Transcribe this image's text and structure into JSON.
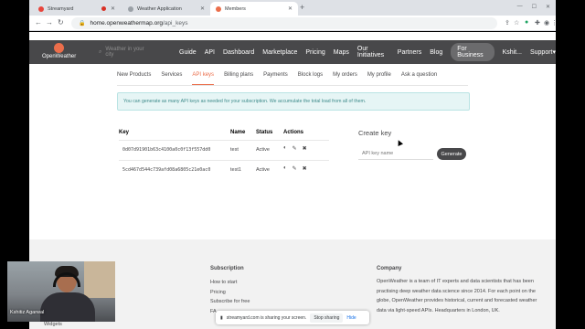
{
  "tabs": [
    {
      "title": "Streamyard",
      "favicon_color": "#e8453c",
      "recording": true
    },
    {
      "title": "Weather Application",
      "favicon_color": "#9aa0a6",
      "recording": false
    },
    {
      "title": "Members",
      "favicon_color": "#eb6e4b",
      "recording": false,
      "active": true
    }
  ],
  "browser": {
    "new_tab": "+",
    "url_host": "home.openweathermap.org",
    "url_path": "/api_keys",
    "back": "←",
    "forward": "→",
    "reload": "↻"
  },
  "site": {
    "brand": "OpenWeather",
    "brand_color": "#eb6e4b",
    "search_placeholder": "Weather in your city",
    "nav": [
      "Guide",
      "API",
      "Dashboard",
      "Marketplace",
      "Pricing",
      "Maps",
      "Our Initiatives",
      "Partners",
      "Blog",
      "For Business",
      "Kshit...",
      "Support▾"
    ]
  },
  "subnav": [
    "New Products",
    "Services",
    "API keys",
    "Billing plans",
    "Payments",
    "Block logs",
    "My orders",
    "My profile",
    "Ask a question"
  ],
  "notice": "You can generate as many API keys as needed for your subscription. We accumulate the total load from all of them.",
  "keys_table": {
    "headers": {
      "key": "Key",
      "name": "Name",
      "status": "Status",
      "actions": "Actions"
    },
    "rows": [
      {
        "key": "0d07d91901b63c4100a0c0f13f557dd0",
        "name": "test",
        "status": "Active"
      },
      {
        "key": "5cd467d544c739afd08a6805c21e0ac0",
        "name": "test1",
        "status": "Active"
      }
    ]
  },
  "create_key": {
    "title": "Create key",
    "placeholder": "API key name",
    "button": "Generate"
  },
  "footer": {
    "subscription_title": "Subscription",
    "subscription_links": [
      "How to start",
      "Pricing",
      "Subscribe for free",
      "FA"
    ],
    "partial_link": "Widgets",
    "company_title": "Company",
    "company_text": "OpenWeather is a team of IT experts and data scientists that has been practising deep weather data science since 2014. For each point on the globe, OpenWeather provides historical, current and forecasted weather data via light-speed APIs. Headquarters in London, UK."
  },
  "share_bar": {
    "text": "streamyard.com is sharing your screen.",
    "stop": "Stop sharing",
    "hide": "Hide"
  },
  "webcam": {
    "name": "Kshitiz Agarwal"
  }
}
